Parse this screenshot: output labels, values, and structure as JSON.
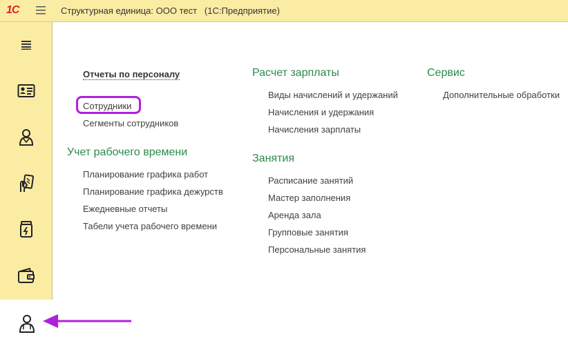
{
  "app": {
    "logo": "1С",
    "title": "Структурная единица: ООО тест   (1С:Предприятие)"
  },
  "sidebar": {
    "items": [
      {
        "name": "menu-icon"
      },
      {
        "name": "id-card-icon"
      },
      {
        "name": "person-icon"
      },
      {
        "name": "card-hand-icon"
      },
      {
        "name": "jar-icon"
      },
      {
        "name": "wallet-icon"
      },
      {
        "name": "staff-icon",
        "active": true
      }
    ]
  },
  "sections": {
    "personnel": {
      "report_link": "Отчеты по персоналу",
      "items": [
        "Сотрудники",
        "Сегменты сотрудников"
      ]
    },
    "work_time": {
      "title": "Учет рабочего времени",
      "items": [
        "Планирование графика работ",
        "Планирование графика дежурств",
        "Ежедневные отчеты",
        "Табели учета рабочего времени"
      ]
    },
    "salary": {
      "title": "Расчет зарплаты",
      "items": [
        "Виды начислений и удержаний",
        "Начисления и удержания",
        "Начисления зарплаты"
      ]
    },
    "classes": {
      "title": "Занятия",
      "items": [
        "Расписание занятий",
        "Мастер заполнения",
        "Аренда зала",
        "Групповые занятия",
        "Персональные занятия"
      ]
    },
    "service": {
      "title": "Сервис",
      "items": [
        "Дополнительные обработки"
      ]
    }
  },
  "colors": {
    "accent": "#b01fdb",
    "section_title": "#2a8a4a",
    "panel_bg": "#fbeca4"
  }
}
